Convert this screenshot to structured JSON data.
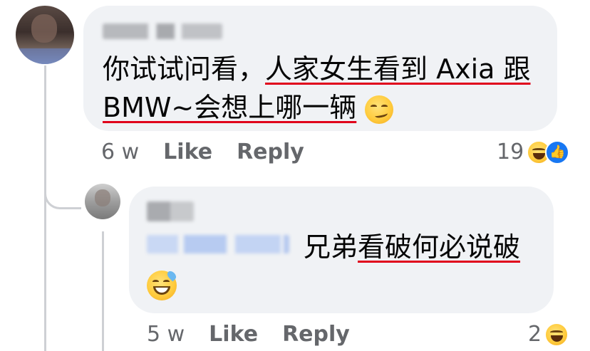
{
  "comment": {
    "text_plain": "你试试问看，",
    "text_underlined_1": "人家女生看到 Axia 跟",
    "text_underlined_2": "BMW~会想上哪一辆",
    "emoji": "smirk-face",
    "time": "6 w",
    "like_label": "Like",
    "reply_label": "Reply",
    "reaction_count": "19",
    "reactions": [
      "haha-icon",
      "like-icon"
    ]
  },
  "reply": {
    "text_plain": "兄弟",
    "text_underlined": "看破何必说破",
    "emoji": "grinning-sweat-face",
    "time": "5 w",
    "like_label": "Like",
    "reply_label": "Reply",
    "reaction_count": "2",
    "reactions": [
      "haha-icon"
    ]
  },
  "colors": {
    "bubble": "#f0f2f5",
    "underline": "#e0001b",
    "meta_text": "#65676b",
    "like_blue": "#1877f2"
  }
}
